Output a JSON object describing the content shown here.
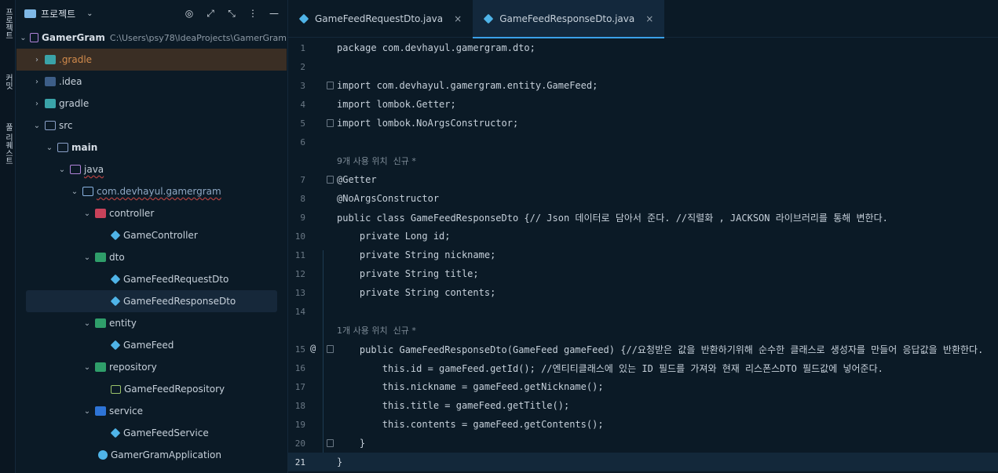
{
  "activity": {
    "project_label": "프로젝트",
    "commit_label": "커밋",
    "pull_requests_label": "풀 리퀘스트"
  },
  "project_panel": {
    "title": "프로젝트",
    "tree": [
      {
        "label": "GamerGram",
        "path": "C:\\Users\\psy78\\IdeaProjects\\GamerGram"
      },
      {
        "label": ".gradle"
      },
      {
        "label": ".idea"
      },
      {
        "label": "gradle"
      },
      {
        "label": "src"
      },
      {
        "label": "main"
      },
      {
        "label": "java"
      },
      {
        "label": "com.devhayul.gamergram"
      },
      {
        "label": "controller"
      },
      {
        "label": "GameController"
      },
      {
        "label": "dto"
      },
      {
        "label": "GameFeedRequestDto"
      },
      {
        "label": "GameFeedResponseDto"
      },
      {
        "label": "entity"
      },
      {
        "label": "GameFeed"
      },
      {
        "label": "repository"
      },
      {
        "label": "GameFeedRepository"
      },
      {
        "label": "service"
      },
      {
        "label": "GameFeedService"
      },
      {
        "label": "GamerGramApplication"
      }
    ]
  },
  "editor": {
    "tabs": [
      {
        "label": "GameFeedRequestDto.java",
        "close": "×"
      },
      {
        "label": "GameFeedResponseDto.java",
        "close": "×"
      }
    ],
    "lines": [
      {
        "num": "1",
        "text": "package com.devhayul.gamergram.dto;"
      },
      {
        "num": "2",
        "text": ""
      },
      {
        "num": "3",
        "text": "import com.devhayul.gamergram.entity.GameFeed;"
      },
      {
        "num": "4",
        "text": "import lombok.Getter;"
      },
      {
        "num": "5",
        "text": "import lombok.NoArgsConstructor;"
      },
      {
        "num": "6",
        "text": ""
      },
      {
        "num": "",
        "text": "9개 사용 위치  신규 *"
      },
      {
        "num": "7",
        "text": "@Getter"
      },
      {
        "num": "8",
        "text": "@NoArgsConstructor"
      },
      {
        "num": "9",
        "text": "public class GameFeedResponseDto {// Json 데이터로 담아서 준다. //직렬화 , JACKSON 라이브러리를 통해 변한다."
      },
      {
        "num": "10",
        "text": "    private Long id;"
      },
      {
        "num": "11",
        "text": "    private String nickname;"
      },
      {
        "num": "12",
        "text": "    private String title;"
      },
      {
        "num": "13",
        "text": "    private String contents;"
      },
      {
        "num": "14",
        "text": ""
      },
      {
        "num": "",
        "text": "1개 사용 위치  신규 *"
      },
      {
        "num": "15",
        "text": "    public GameFeedResponseDto(GameFeed gameFeed) {//요청받은 값을 반환하기위해 순수한 클래스로 생성자를 만들어 응답값을 반환한다."
      },
      {
        "num": "16",
        "text": "        this.id = gameFeed.getId(); //엔티티클래스에 있는 ID 필드를 가져와 현재 리스폰스DTO 필드값에 넣어준다."
      },
      {
        "num": "17",
        "text": "        this.nickname = gameFeed.getNickname();"
      },
      {
        "num": "18",
        "text": "        this.title = gameFeed.getTitle();"
      },
      {
        "num": "19",
        "text": "        this.contents = gameFeed.getContents();"
      },
      {
        "num": "20",
        "text": "    }"
      },
      {
        "num": "21",
        "text": "}"
      }
    ],
    "gutter_marker": "@"
  }
}
